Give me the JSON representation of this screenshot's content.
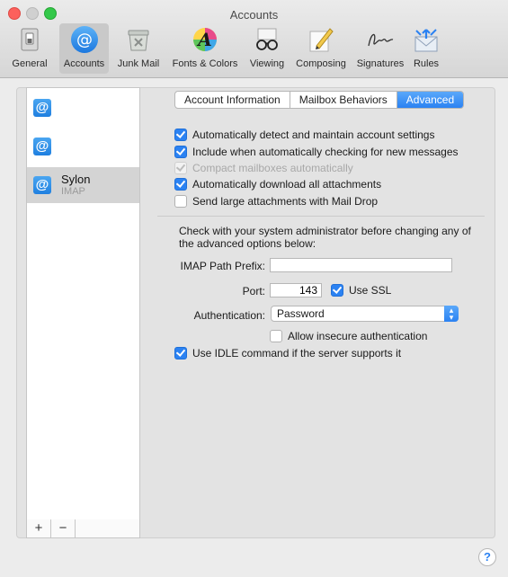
{
  "window": {
    "title": "Accounts"
  },
  "toolbar": [
    {
      "label": "General",
      "icon": "general-switch-icon"
    },
    {
      "label": "Accounts",
      "icon": "at-sign-icon",
      "selected": true
    },
    {
      "label": "Junk Mail",
      "icon": "junk-mail-icon"
    },
    {
      "label": "Fonts & Colors",
      "icon": "fonts-colors-icon"
    },
    {
      "label": "Viewing",
      "icon": "eyeglasses-icon"
    },
    {
      "label": "Composing",
      "icon": "pencil-paper-icon"
    },
    {
      "label": "Signatures",
      "icon": "signature-icon"
    },
    {
      "label": "Rules",
      "icon": "rules-envelope-icon"
    }
  ],
  "sidebar": {
    "accounts": [
      {
        "name": "",
        "type": "",
        "icon": "@"
      },
      {
        "name": "",
        "type": "",
        "icon": "@"
      },
      {
        "name": "Sylon",
        "type": "IMAP",
        "icon": "@",
        "selected": true
      }
    ],
    "add_label": "+",
    "remove_label": "−"
  },
  "tabs": [
    {
      "label": "Account Information"
    },
    {
      "label": "Mailbox Behaviors"
    },
    {
      "label": "Advanced",
      "selected": true
    }
  ],
  "options": {
    "auto_detect": {
      "label": "Automatically detect and maintain account settings",
      "checked": true
    },
    "include_checking": {
      "label": "Include when automatically checking for new messages",
      "checked": true
    },
    "compact": {
      "label": "Compact mailboxes automatically",
      "checked": true,
      "disabled": true
    },
    "download_attachments": {
      "label": "Automatically download all attachments",
      "checked": true
    },
    "mail_drop": {
      "label": "Send large attachments with Mail Drop",
      "checked": false
    }
  },
  "admin_note": "Check with your system administrator before changing any of the advanced options below:",
  "imap_path_prefix": {
    "label": "IMAP Path Prefix:",
    "value": ""
  },
  "port": {
    "label": "Port:",
    "value": "143"
  },
  "use_ssl": {
    "label": "Use SSL",
    "checked": true
  },
  "authentication": {
    "label": "Authentication:",
    "value": "Password"
  },
  "allow_insecure": {
    "label": "Allow insecure authentication",
    "checked": false
  },
  "use_idle": {
    "label": "Use IDLE command if the server supports it",
    "checked": true
  },
  "help_label": "?",
  "colors": {
    "accent": "#2b82f2",
    "selected_row": "#d4d4d4",
    "window_bg": "#ececec"
  }
}
